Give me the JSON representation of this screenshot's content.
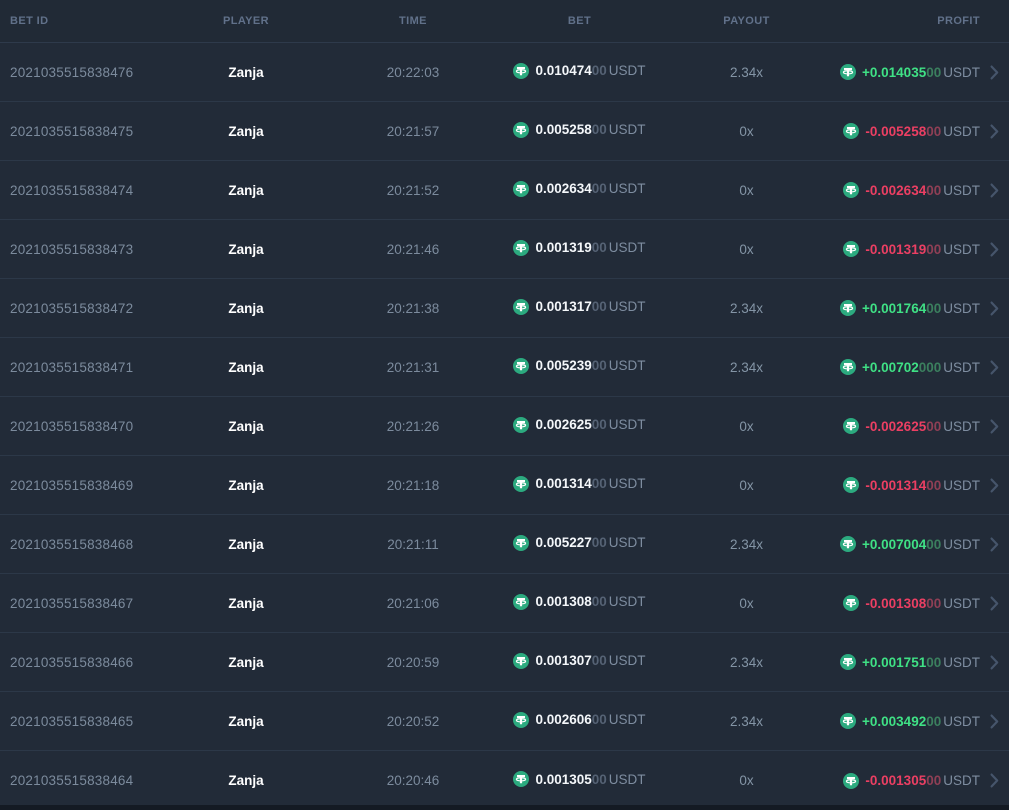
{
  "table": {
    "currency_label": "USDT",
    "columns": {
      "bet_id": "BET ID",
      "player": "PLAYER",
      "time": "TIME",
      "bet": "BET",
      "payout": "PAYOUT",
      "profit": "PROFIT"
    },
    "rows": [
      {
        "bet_id": "2021035515838476",
        "player": "Zanja",
        "time": "20:22:03",
        "bet_main": "0.010474",
        "bet_dim": "00",
        "payout": "2.34x",
        "profit_main": "+0.014035",
        "profit_dim": "00",
        "profit_type": "win"
      },
      {
        "bet_id": "2021035515838475",
        "player": "Zanja",
        "time": "20:21:57",
        "bet_main": "0.005258",
        "bet_dim": "00",
        "payout": "0x",
        "profit_main": "-0.005258",
        "profit_dim": "00",
        "profit_type": "loss"
      },
      {
        "bet_id": "2021035515838474",
        "player": "Zanja",
        "time": "20:21:52",
        "bet_main": "0.002634",
        "bet_dim": "00",
        "payout": "0x",
        "profit_main": "-0.002634",
        "profit_dim": "00",
        "profit_type": "loss"
      },
      {
        "bet_id": "2021035515838473",
        "player": "Zanja",
        "time": "20:21:46",
        "bet_main": "0.001319",
        "bet_dim": "00",
        "payout": "0x",
        "profit_main": "-0.001319",
        "profit_dim": "00",
        "profit_type": "loss"
      },
      {
        "bet_id": "2021035515838472",
        "player": "Zanja",
        "time": "20:21:38",
        "bet_main": "0.001317",
        "bet_dim": "00",
        "payout": "2.34x",
        "profit_main": "+0.001764",
        "profit_dim": "00",
        "profit_type": "win"
      },
      {
        "bet_id": "2021035515838471",
        "player": "Zanja",
        "time": "20:21:31",
        "bet_main": "0.005239",
        "bet_dim": "00",
        "payout": "2.34x",
        "profit_main": "+0.00702",
        "profit_dim": "000",
        "profit_type": "win"
      },
      {
        "bet_id": "2021035515838470",
        "player": "Zanja",
        "time": "20:21:26",
        "bet_main": "0.002625",
        "bet_dim": "00",
        "payout": "0x",
        "profit_main": "-0.002625",
        "profit_dim": "00",
        "profit_type": "loss"
      },
      {
        "bet_id": "2021035515838469",
        "player": "Zanja",
        "time": "20:21:18",
        "bet_main": "0.001314",
        "bet_dim": "00",
        "payout": "0x",
        "profit_main": "-0.001314",
        "profit_dim": "00",
        "profit_type": "loss"
      },
      {
        "bet_id": "2021035515838468",
        "player": "Zanja",
        "time": "20:21:11",
        "bet_main": "0.005227",
        "bet_dim": "00",
        "payout": "2.34x",
        "profit_main": "+0.007004",
        "profit_dim": "00",
        "profit_type": "win"
      },
      {
        "bet_id": "2021035515838467",
        "player": "Zanja",
        "time": "20:21:06",
        "bet_main": "0.001308",
        "bet_dim": "00",
        "payout": "0x",
        "profit_main": "-0.001308",
        "profit_dim": "00",
        "profit_type": "loss"
      },
      {
        "bet_id": "2021035515838466",
        "player": "Zanja",
        "time": "20:20:59",
        "bet_main": "0.001307",
        "bet_dim": "00",
        "payout": "2.34x",
        "profit_main": "+0.001751",
        "profit_dim": "00",
        "profit_type": "win"
      },
      {
        "bet_id": "2021035515838465",
        "player": "Zanja",
        "time": "20:20:52",
        "bet_main": "0.002606",
        "bet_dim": "00",
        "payout": "2.34x",
        "profit_main": "+0.003492",
        "profit_dim": "00",
        "profit_type": "win"
      },
      {
        "bet_id": "2021035515838464",
        "player": "Zanja",
        "time": "20:20:46",
        "bet_main": "0.001305",
        "bet_dim": "00",
        "payout": "0x",
        "profit_main": "-0.001305",
        "profit_dim": "00",
        "profit_type": "loss"
      }
    ],
    "icons": {
      "currency_icon": "tether-usdt-icon",
      "row_action_icon": "chevron-right-icon"
    },
    "colors": {
      "row_background": "#222b38",
      "header_text": "#61718a",
      "positive": "#3fe185",
      "negative": "#ec3f63",
      "tether_green": "#2caa7f"
    }
  }
}
